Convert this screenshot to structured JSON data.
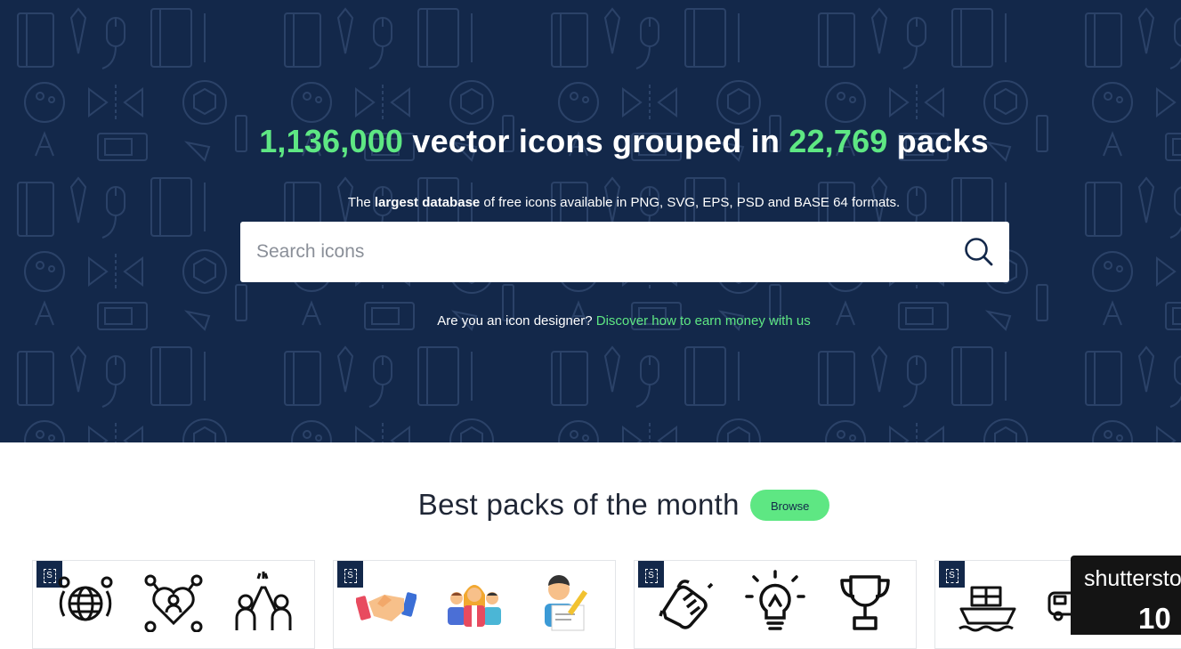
{
  "hero": {
    "title_count_icons": "1,136,000",
    "title_mid": " vector icons grouped in ",
    "title_count_packs": "22,769",
    "title_end": " packs",
    "subtitle_pre": "The ",
    "subtitle_bold": "largest database",
    "subtitle_post": " of free icons available in PNG, SVG, EPS, PSD and BASE 64 formats.",
    "designer_question": "Are you an icon designer? ",
    "designer_link": "Discover how to earn money with us"
  },
  "search": {
    "placeholder": "Search icons",
    "value": "",
    "icon": "search-icon"
  },
  "section": {
    "title": "Best packs of the month",
    "browse_label": "Browse"
  },
  "packs": [
    {
      "badge": "S",
      "icons": [
        "globe-network-icon",
        "heart-network-icon",
        "high-five-icon"
      ]
    },
    {
      "badge": "S",
      "icons": [
        "handshake-icon",
        "business-team-icon",
        "signing-document-icon"
      ]
    },
    {
      "badge": "S",
      "icons": [
        "clasped-hands-icon",
        "lightbulb-icon",
        "trophy-icon"
      ]
    },
    {
      "badge": "S",
      "icons": [
        "cargo-ship-icon",
        "bus-icon"
      ]
    }
  ],
  "ad": {
    "brand": "shutterstock",
    "number": "10"
  },
  "colors": {
    "hero_bg": "#13284a",
    "accent": "#5ee783",
    "text_dark": "#1f2635"
  }
}
